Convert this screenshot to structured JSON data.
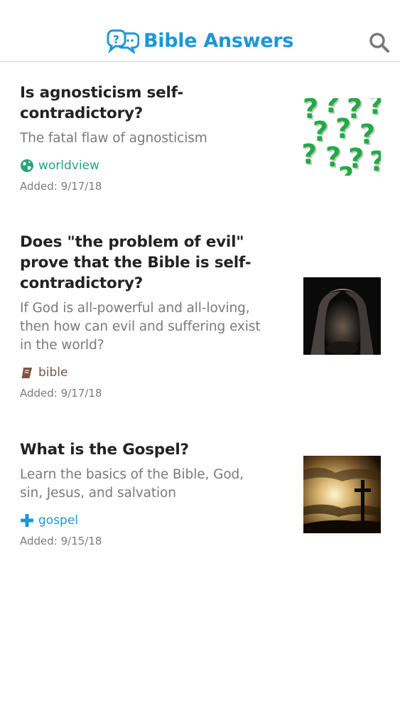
{
  "header": {
    "title": "Bible Answers",
    "logo_icon": "question-speech-bubbles-icon",
    "search_icon": "search-icon",
    "accent": "#1e96d8"
  },
  "articles": [
    {
      "title": "Is agnosticism self-contradictory?",
      "title_lines": [
        "Is agnosticism self-",
        "contradictory?"
      ],
      "subtitle": "The fatal flaw of agnosticism",
      "subtitle_lines": [
        "The fatal flaw of agnosticism"
      ],
      "tag": "worldview",
      "tag_icon": "globe-icon",
      "tag_color": "#2aa37a",
      "date": "Added: 9/17/18",
      "thumbnail": "question-marks-image"
    },
    {
      "title": "Does \"the problem of evil\" prove that the Bible is self-contradictory?",
      "title_lines": [
        "Does \"the problem of evil\"",
        "prove that the Bible is self-",
        "contradictory?"
      ],
      "subtitle": "If God is all-powerful and all-loving, then how can evil and suffering exist in the world?",
      "subtitle_lines": [
        "If God is all-powerful and all-loving,",
        "then how can evil and suffering exist",
        "in the world?"
      ],
      "tag": "bible",
      "tag_icon": "book-icon",
      "tag_color": "#7a5540",
      "date": "Added: 9/17/18",
      "thumbnail": "suffering-man-image"
    },
    {
      "title": "What is the Gospel?",
      "title_lines": [
        "What is the Gospel?"
      ],
      "subtitle": "Learn the basics of the Bible, God, sin, Jesus, and salvation",
      "subtitle_lines": [
        "Learn the basics of the Bible, God,",
        "sin, Jesus, and salvation"
      ],
      "tag": "gospel",
      "tag_icon": "plus-icon",
      "tag_color": "#1e96d8",
      "date": "Added: 9/15/18",
      "thumbnail": "cross-sunset-image"
    }
  ]
}
